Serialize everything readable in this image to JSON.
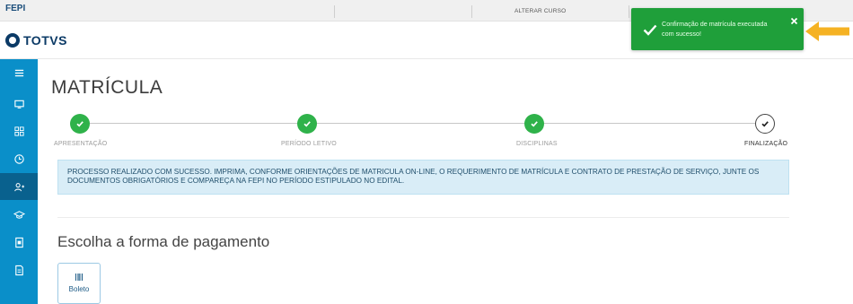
{
  "topbar": {
    "org": "FEPI",
    "course_link": "ALTERAR CURSO"
  },
  "logo": {
    "text": "TOTVS"
  },
  "sidebar": {
    "items": [
      {
        "icon": "menu-icon"
      },
      {
        "icon": "monitor-icon"
      },
      {
        "icon": "grid-icon"
      },
      {
        "icon": "clock-icon"
      },
      {
        "icon": "user-add-icon",
        "active": true
      },
      {
        "icon": "graduation-cap-icon"
      },
      {
        "icon": "document-icon"
      },
      {
        "icon": "file-text-icon"
      }
    ]
  },
  "page": {
    "title": "MATRÍCULA"
  },
  "steps": [
    {
      "label": "APRESENTAÇÃO",
      "status": "done"
    },
    {
      "label": "PERÍODO LETIVO",
      "status": "done"
    },
    {
      "label": "DISCIPLINAS",
      "status": "done"
    },
    {
      "label": "FINALIZAÇÃO",
      "status": "current"
    }
  ],
  "alert": {
    "text": "PROCESSO REALIZADO COM SUCESSO. IMPRIMA, CONFORME ORIENTAÇÕES DE MATRICULA ON-LINE, O REQUERIMENTO DE MATRÍCULA E CONTRATO DE PRESTAÇÃO DE SERVIÇO, JUNTE OS DOCUMENTOS OBRIGATÓRIOS E COMPAREÇA NA FEPI NO PERÍODO ESTIPULADO NO EDITAL."
  },
  "payment": {
    "heading": "Escolha a forma de pagamento",
    "options": [
      {
        "label": "Boleto",
        "icon": "barcode-icon"
      }
    ]
  },
  "toast": {
    "message": "Confirmação de matrícula executada com sucesso!",
    "close_label": "×"
  },
  "colors": {
    "sidebar": "#0a8fc9",
    "sidebar_active": "#09618e",
    "success": "#2fb24a",
    "toast": "#1f9f3a",
    "alert_bg": "#d9edf7",
    "arrow": "#f5b223"
  }
}
